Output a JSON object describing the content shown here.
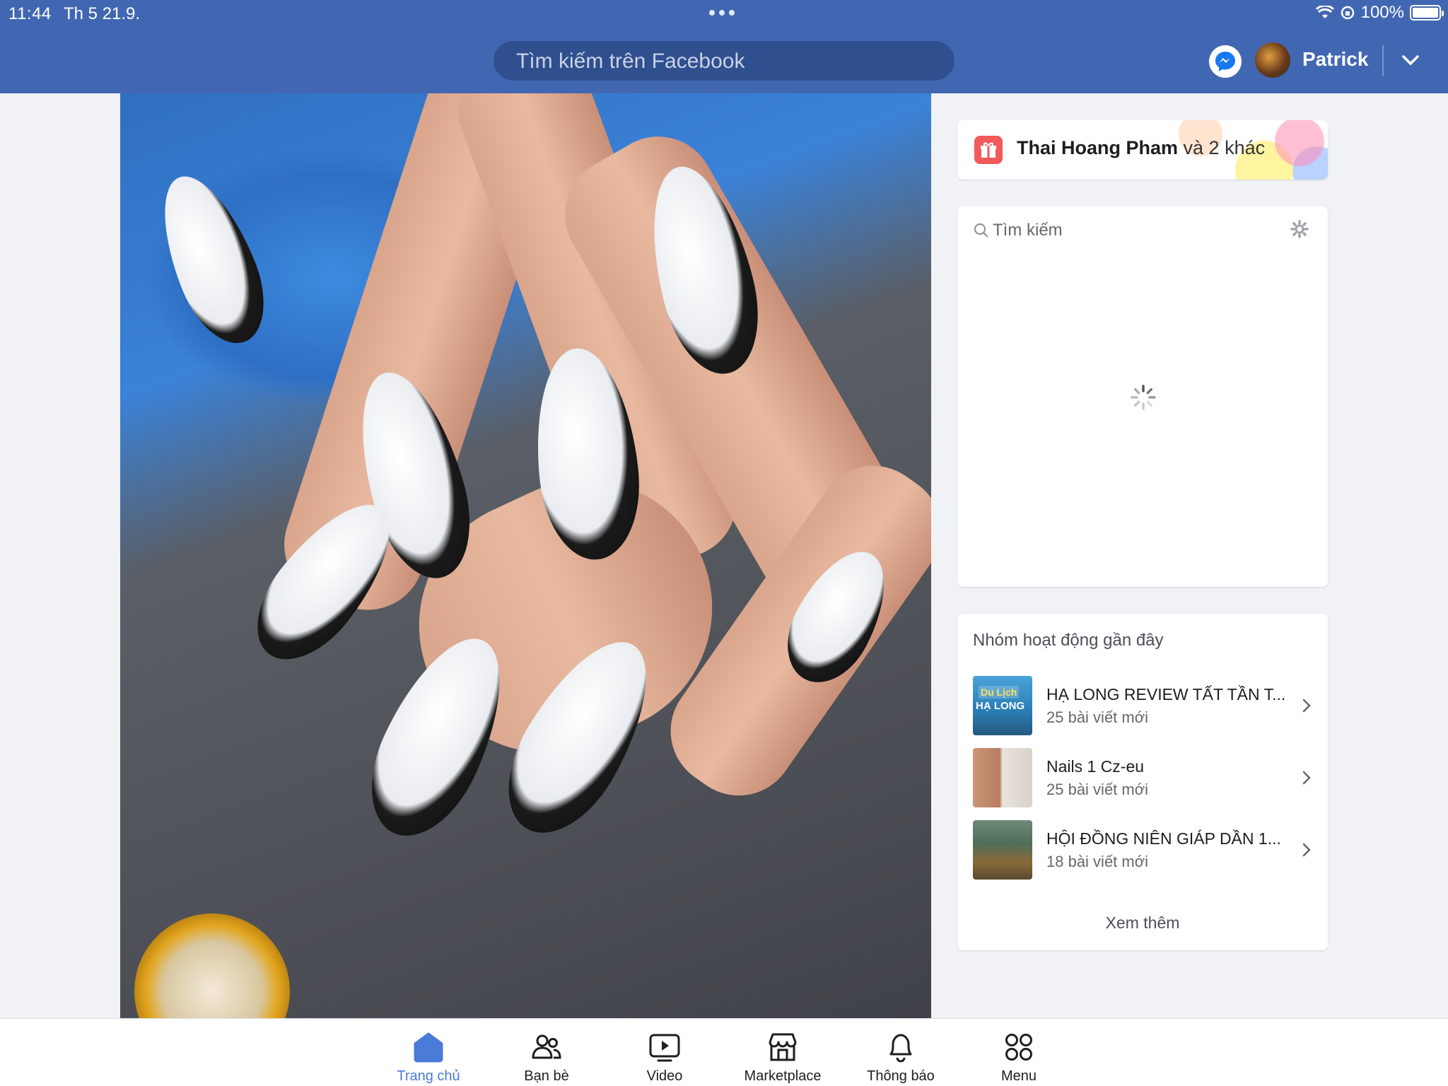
{
  "status_bar": {
    "time": "11:44",
    "date": "Th 5 21.9.",
    "battery": "100%",
    "battery_level": 1.0
  },
  "header": {
    "search_placeholder": "Tìm kiếm trên Facebook",
    "user_name": "Patrick",
    "brand_color": "#4267b2"
  },
  "birthday": {
    "name": "Thai Hoang Pham",
    "suffix": " và 2 khác",
    "icon": "gift-icon"
  },
  "contacts": {
    "search_placeholder": "Tìm kiếm"
  },
  "groups": {
    "title": "Nhóm hoạt động gần đây",
    "items": [
      {
        "name": "HẠ LONG REVIEW TẤT TẦN T...",
        "sub": "25 bài viết mới",
        "thumb_label_1": "Du Lịch",
        "thumb_label_2": "HẠ LONG"
      },
      {
        "name": "Nails 1 Cz-eu",
        "sub": "25 bài viết mới"
      },
      {
        "name": "HỘI ĐỒNG NIÊN GIÁP DẦN 1...",
        "sub": "18 bài viết mới"
      }
    ],
    "see_more": "Xem thêm"
  },
  "tabbar": {
    "items": [
      {
        "label": "Trang chủ",
        "icon": "home-icon"
      },
      {
        "label": "Bạn bè",
        "icon": "friends-icon"
      },
      {
        "label": "Video",
        "icon": "video-icon"
      },
      {
        "label": "Marketplace",
        "icon": "marketplace-icon"
      },
      {
        "label": "Thông báo",
        "icon": "bell-icon"
      },
      {
        "label": "Menu",
        "icon": "menu-grid-icon"
      }
    ],
    "active_color": "#4a7bd8"
  }
}
